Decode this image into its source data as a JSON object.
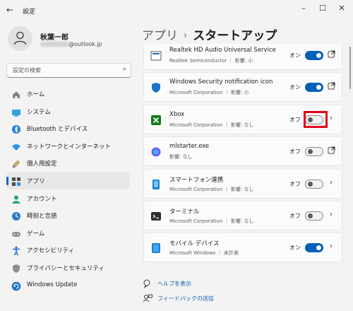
{
  "window": {
    "title": "設定"
  },
  "user": {
    "name": "秋葉一郎",
    "email_suffix": "@outlook.jp"
  },
  "search": {
    "placeholder": "設定の検索"
  },
  "nav": {
    "items": [
      {
        "label": "ホーム",
        "icon": "home-icon"
      },
      {
        "label": "システム",
        "icon": "monitor-icon"
      },
      {
        "label": "Bluetooth とデバイス",
        "icon": "bluetooth-icon"
      },
      {
        "label": "ネットワークとインターネット",
        "icon": "wifi-icon"
      },
      {
        "label": "個人用設定",
        "icon": "brush-icon"
      },
      {
        "label": "アプリ",
        "icon": "apps-icon",
        "active": true
      },
      {
        "label": "アカウント",
        "icon": "person-icon"
      },
      {
        "label": "時刻と言語",
        "icon": "clock-globe-icon"
      },
      {
        "label": "ゲーム",
        "icon": "gamepad-icon"
      },
      {
        "label": "アクセシビリティ",
        "icon": "accessibility-icon"
      },
      {
        "label": "プライバシーとセキュリティ",
        "icon": "shield-icon"
      },
      {
        "label": "Windows Update",
        "icon": "update-icon"
      }
    ]
  },
  "breadcrumb": {
    "parent": "アプリ",
    "separator": "›",
    "current": "スタートアップ"
  },
  "apps": [
    {
      "name": "Realtek HD Audio Universal Service",
      "publisher": "Realtek Semiconductor",
      "impact": "影響: 小",
      "state": "オン",
      "on": true,
      "trailing": "open-external-icon"
    },
    {
      "name": "Windows Security notification icon",
      "publisher": "Microsoft Corporation",
      "impact": "影響: 小",
      "state": "オン",
      "on": true,
      "trailing": "open-external-icon"
    },
    {
      "name": "Xbox",
      "publisher": "Microsoft Corporation",
      "impact": "影響: なし",
      "state": "オフ",
      "on": false,
      "trailing": "chevron-right-icon",
      "highlighted": true
    },
    {
      "name": "mlstarter.exe",
      "publisher": "",
      "impact": "影響: なし",
      "state": "オフ",
      "on": false,
      "trailing": "open-external-icon"
    },
    {
      "name": "スマートフォン連携",
      "publisher": "Microsoft Corporation",
      "impact": "影響: なし",
      "state": "オフ",
      "on": false,
      "trailing": "chevron-right-icon"
    },
    {
      "name": "ターミナル",
      "publisher": "Microsoft Corporation",
      "impact": "影響: なし",
      "state": "オフ",
      "on": false,
      "trailing": "chevron-right-icon"
    },
    {
      "name": "モバイル デバイス",
      "publisher": "Microsoft Windows",
      "impact": "未計測",
      "state": "オン",
      "on": true,
      "trailing": "chevron-right-icon"
    }
  ],
  "footer": {
    "help": "ヘルプを表示",
    "feedback": "フィードバックの送信"
  },
  "colors": {
    "accent": "#005fb8",
    "highlight": "#e4001b"
  }
}
